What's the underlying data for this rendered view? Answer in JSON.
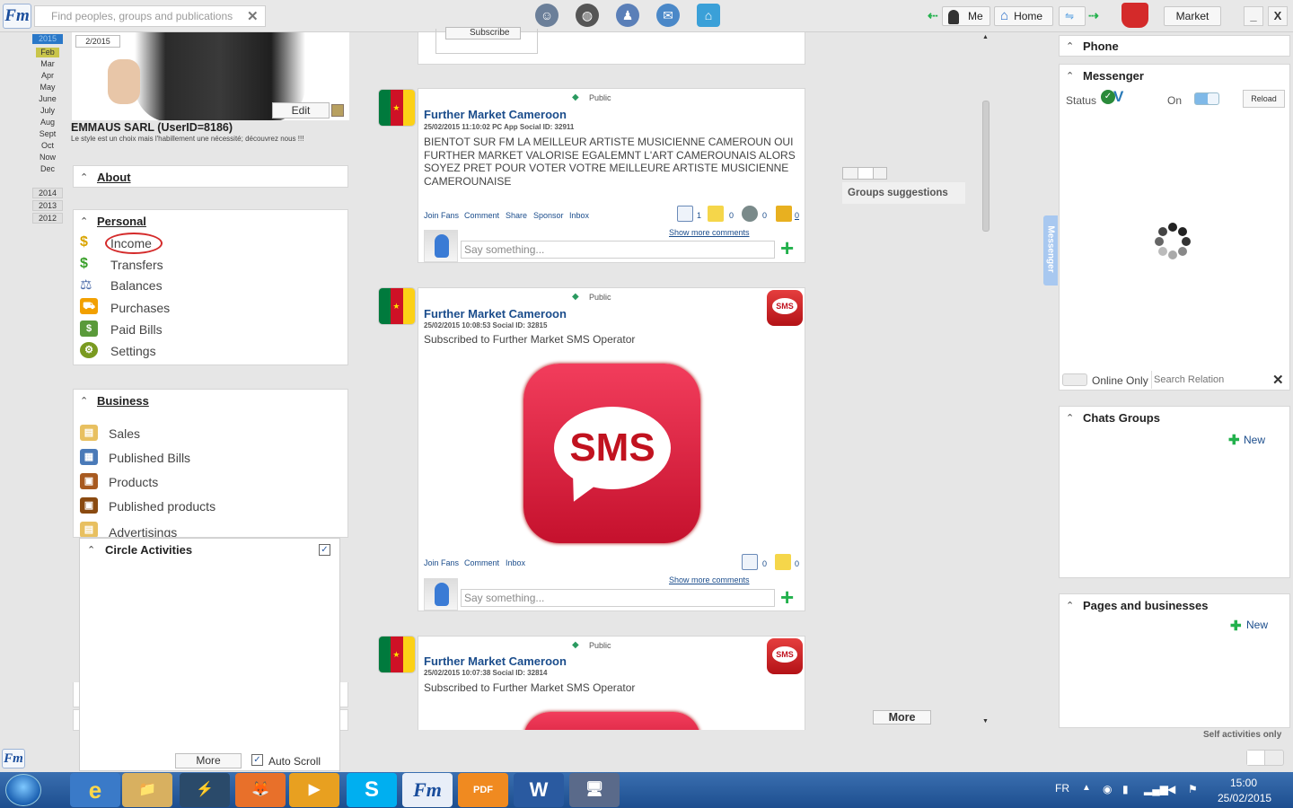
{
  "topbar": {
    "logo": "Fm",
    "search_placeholder": "Find peoples, groups and publications",
    "me_label": "Me",
    "home_label": "Home",
    "market_label": "Market",
    "minimize_label": "_",
    "close_label": "X"
  },
  "timeline": {
    "current_year": "2015",
    "months": [
      "Feb",
      "Mar",
      "Apr",
      "May",
      "June",
      "July",
      "Aug",
      "Sept",
      "Oct",
      "Now",
      "Dec"
    ],
    "years": [
      "2014",
      "2013",
      "2012"
    ]
  },
  "profile": {
    "date": "2/2015",
    "edit_label": "Edit",
    "name": "EMMAUS SARL (UserID=8186)",
    "tagline": "Le style est un choix mais l'habillement une nécessité; découvrez nous !!!"
  },
  "about": {
    "title": "About"
  },
  "personal": {
    "title": "Personal",
    "items": [
      "Income",
      "Transfers",
      "Balances",
      "Purchases",
      "Paid Bills",
      "Settings"
    ]
  },
  "business": {
    "title": "Business",
    "items": [
      "Sales",
      "Published Bills",
      "Products",
      "Published products",
      "Advertisings"
    ]
  },
  "circle": {
    "title": "Circle Activities",
    "more_label": "More",
    "autoscroll_label": "Auto Scroll"
  },
  "subscribe_label": "Subscribe",
  "posts": [
    {
      "visibility": "Public",
      "author": "Further Market Cameroon",
      "meta": "25/02/2015 11:10:02  PC App  Social ID: 32911",
      "text": "BIENTOT SUR FM LA MEILLEUR ARTISTE MUSICIENNE CAMEROUN OUI FURTHER MARKET VALORISE EGALEMNT L'ART CAMEROUNAIS ALORS SOYEZ PRET POUR VOTER VOTRE MEILLEURE ARTISTE MUSICIENNE CAMEROUNAISE",
      "actions": [
        "Join Fans",
        "Comment",
        "Share",
        "Sponsor",
        "Inbox"
      ],
      "counts": [
        "1",
        "0",
        "0",
        "0"
      ],
      "show_more": "Show more comments",
      "say_placeholder": "Say something..."
    },
    {
      "visibility": "Public",
      "author": "Further Market Cameroon",
      "meta": "25/02/2015 10:08:53   Social ID: 32815",
      "text": "Subscribed to Further Market SMS Operator",
      "badge": "SMS",
      "image_text": "SMS",
      "actions": [
        "Join Fans",
        "Comment",
        "Inbox"
      ],
      "counts": [
        "0",
        "0"
      ],
      "show_more": "Show more comments",
      "say_placeholder": "Say something..."
    },
    {
      "visibility": "Public",
      "author": "Further Market Cameroon",
      "meta": "25/02/2015 10:07:38   Social ID: 32814",
      "text": "Subscribed to Further Market SMS Operator",
      "badge": "SMS"
    }
  ],
  "groups_suggestions": "Groups suggestions",
  "feed_more": "More",
  "messenger_tab": "Messenger",
  "phone": {
    "title": "Phone"
  },
  "messenger": {
    "title": "Messenger",
    "status_label": "Status",
    "on_label": "On",
    "reload_label": "Reload",
    "online_only": "Online Only",
    "search_placeholder": "Search Relation"
  },
  "chats": {
    "title": "Chats Groups",
    "new_label": "New"
  },
  "pages": {
    "title": "Pages and businesses",
    "new_label": "New"
  },
  "self_activities": "Self activities only",
  "taskbar": {
    "lang": "FR",
    "time": "15:00",
    "date": "25/02/2015",
    "apps": [
      "e",
      "📁",
      "⚡",
      "🦊",
      "▶",
      "S",
      "Fm",
      "PDF",
      "W",
      "🖥"
    ]
  }
}
